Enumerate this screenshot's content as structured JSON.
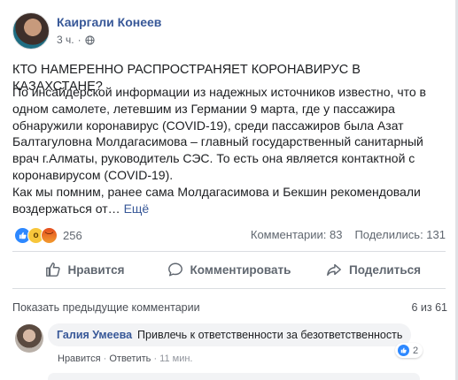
{
  "post": {
    "author": "Каиргали Конеев",
    "time": "3 ч.",
    "headline": "КТО НАМЕРЕННО РАСПРОСТРАНЯЕТ КОРОНАВИРУС В КАЗАХСТАНЕ?",
    "paragraph": "По инсайдерской информации из надежных источников известно, что в одном самолете, летевшим из Германии 9 марта, где у пассажира обнаружили коронавирус (COVID-19), среди пассажиров была Азат Балтагуловна Молдагасимова – главный государственный санитарный врач г.Алматы, руководитель СЭС. То есть она является контактной с коронавирусом (COVID-19).",
    "paragraph2": "Как мы помним, ранее сама Молдагасимова и Бекшин рекомендовали воздержаться от…",
    "see_more": "Ещё"
  },
  "stats": {
    "reaction_count": "256",
    "comments": "Комментарии: 83",
    "shares": "Поделились: 131"
  },
  "actions": {
    "like": "Нравится",
    "comment": "Комментировать",
    "share": "Поделиться"
  },
  "comments_section": {
    "show_previous": "Показать предыдущие комментарии",
    "counter": "6 из 61",
    "comment": {
      "author": "Галия Умеева",
      "text": "Привлечь к ответственности за безответственность",
      "likes": "2",
      "like_label": "Нравится",
      "reply_label": "Ответить",
      "time": "11 мин."
    }
  },
  "icons": {
    "reactions": [
      "like-icon",
      "wow-icon",
      "angry-icon"
    ],
    "actions": [
      "thumb-up-icon",
      "comment-icon",
      "share-icon"
    ]
  },
  "colors": {
    "link": "#385898",
    "like_blue": "#2d88ff",
    "muted": "#606770"
  }
}
